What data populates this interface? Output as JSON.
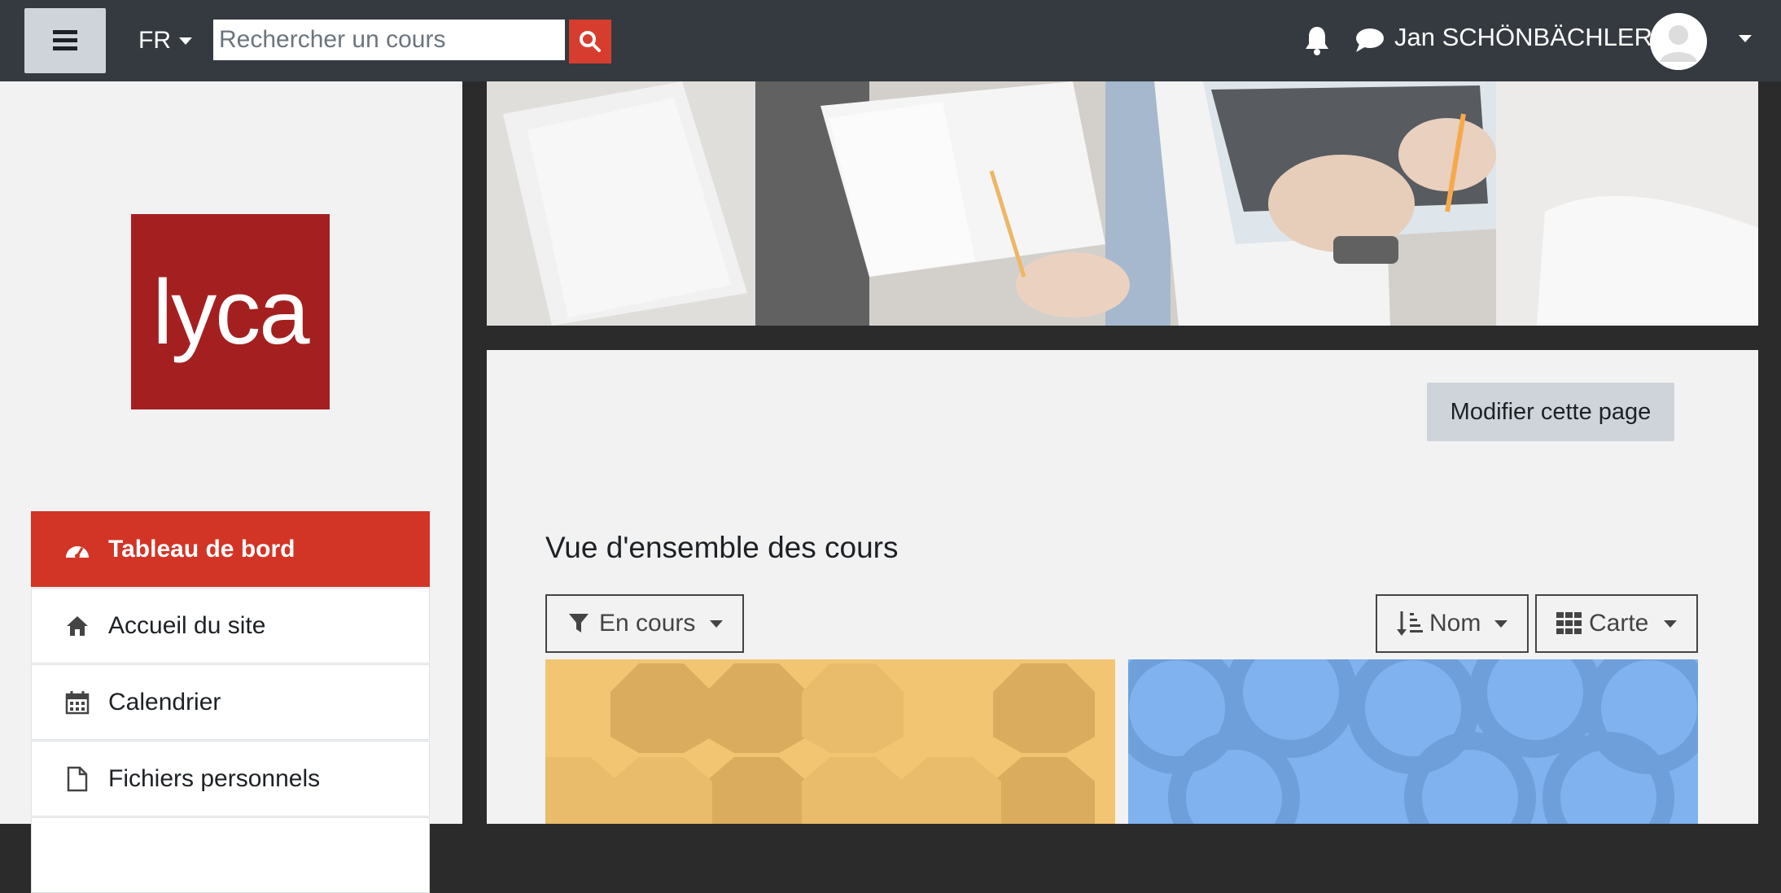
{
  "header": {
    "language": "FR",
    "search_placeholder": "Rechercher un cours",
    "user_name": "Jan SCHÖNBÄCHLER"
  },
  "sidebar": {
    "logo_text": "lyca",
    "items": [
      {
        "label": "Tableau de bord",
        "icon": "dashboard-icon",
        "active": true
      },
      {
        "label": "Accueil du site",
        "icon": "home-icon"
      },
      {
        "label": "Calendrier",
        "icon": "calendar-icon"
      },
      {
        "label": "Fichiers personnels",
        "icon": "file-icon"
      }
    ]
  },
  "main": {
    "edit_button": "Modifier cette page",
    "section_title": "Vue d'ensemble des cours",
    "filter_label": "En cours",
    "sort_label": "Nom",
    "view_label": "Carte"
  },
  "colors": {
    "navbar": "#343a40",
    "accent": "#d23526",
    "logo_bg": "#a42020",
    "card_yellow": "#f2c572",
    "card_blue": "#7fb2ef"
  }
}
